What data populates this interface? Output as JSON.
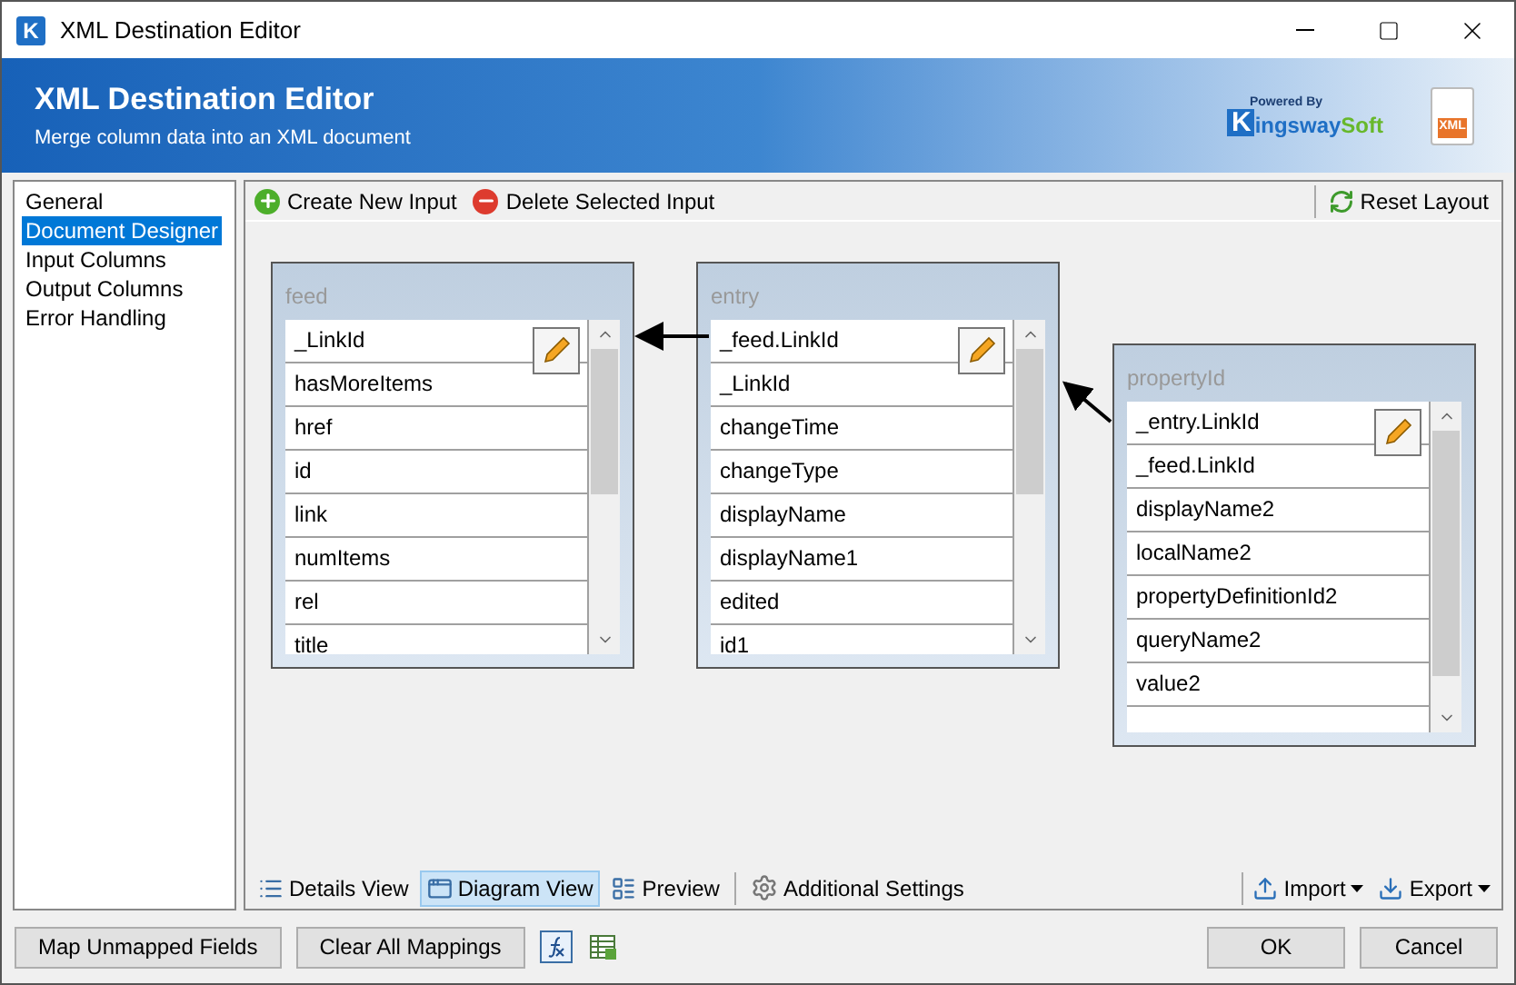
{
  "window": {
    "title": "XML Destination Editor",
    "logo_letter": "K"
  },
  "banner": {
    "title": "XML Destination Editor",
    "subtitle": "Merge column data into an XML document",
    "brand": {
      "tagline": "Powered By",
      "initial": "K",
      "name": "ingsway",
      "suffix": "Soft"
    },
    "file_badge": "XML"
  },
  "sidebar": {
    "items": [
      {
        "label": "General",
        "selected": false
      },
      {
        "label": "Document Designer",
        "selected": true
      },
      {
        "label": "Input Columns",
        "selected": false
      },
      {
        "label": "Output Columns",
        "selected": false
      },
      {
        "label": "Error Handling",
        "selected": false
      }
    ]
  },
  "toolbar": {
    "create": "Create New Input",
    "delete": "Delete Selected Input",
    "reset": "Reset Layout"
  },
  "nodes": [
    {
      "title": "feed",
      "fields": [
        "_LinkId",
        "hasMoreItems",
        "href",
        "id",
        "link",
        "numItems",
        "rel",
        "title"
      ]
    },
    {
      "title": "entry",
      "fields": [
        "_feed.LinkId",
        "_LinkId",
        "changeTime",
        "changeType",
        "displayName",
        "displayName1",
        "edited",
        "id1"
      ]
    },
    {
      "title": "propertyId",
      "fields": [
        "_entry.LinkId",
        "_feed.LinkId",
        "displayName2",
        "localName2",
        "propertyDefinitionId2",
        "queryName2",
        "value2"
      ]
    }
  ],
  "view_tabs": [
    {
      "label": "Details View",
      "kind": "details",
      "selected": false
    },
    {
      "label": "Diagram View",
      "kind": "diagram",
      "selected": true
    },
    {
      "label": "Preview",
      "kind": "preview",
      "selected": false
    },
    {
      "label": "Additional Settings",
      "kind": "settings",
      "selected": false
    }
  ],
  "menus": [
    {
      "label": "Import",
      "kind": "import"
    },
    {
      "label": "Export",
      "kind": "export"
    }
  ],
  "footer": {
    "left": [
      "Map Unmapped Fields",
      "Clear All Mappings"
    ],
    "ok": "OK",
    "cancel": "Cancel"
  }
}
